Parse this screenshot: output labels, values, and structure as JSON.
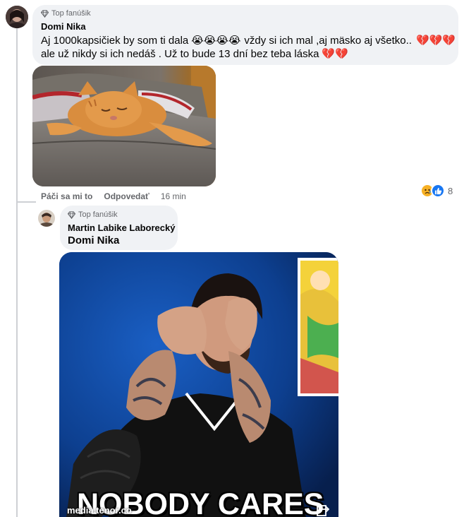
{
  "comment1": {
    "badge": "Top fanúšik",
    "author": "Domi Nika",
    "line1_text": "Aj 1000kapsičiek by som ti dala",
    "line1_emoji": "😭😭😭😭",
    "line1_text2": "vždy si ich mal ,aj mäsko aj všetko..",
    "line1_emoji2": "💔💔💔",
    "line2_text": "ale už nikdy si ich nedáš . Už to bude 13 dní bez teba láska",
    "line2_emoji": "💔💔",
    "actions": {
      "like": "Páči sa mi to",
      "reply": "Odpovedať",
      "time": "16 min"
    },
    "reactions": {
      "icons": [
        "sad-react",
        "like-react"
      ],
      "count": "8"
    }
  },
  "reply1": {
    "badge": "Top fanúšik",
    "author": "Martin Labike Laborecký",
    "tagged_name": "Domi Nika",
    "gif": {
      "source": "media.tenor.co",
      "caption": "NOBODY CARES"
    }
  },
  "colors": {
    "bubble": "#f0f2f5",
    "secondary_text": "#65676b",
    "like_blue": "#1877f2",
    "sad_yellow": "#f7b125",
    "gif_bg": "#0d3f8f"
  }
}
